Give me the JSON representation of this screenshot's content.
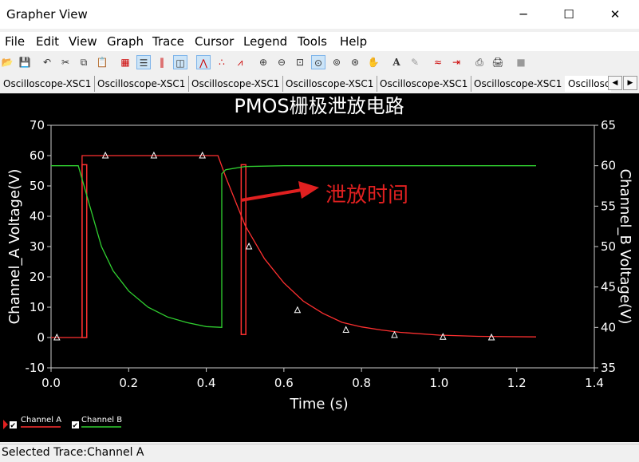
{
  "window": {
    "title": "Grapher View",
    "minimize": "─",
    "maximize": "☐",
    "close": "✕"
  },
  "menu": [
    "File",
    "Edit",
    "View",
    "Graph",
    "Trace",
    "Cursor",
    "Legend",
    "Tools",
    "Help"
  ],
  "toolbar_icons": [
    "open-icon",
    "save-icon",
    "undo-icon",
    "cut-icon",
    "copy-icon",
    "paste-icon",
    "grid-icon",
    "legend-icon",
    "cursors-icon",
    "overlay-icon",
    "line-trace-icon",
    "dot-trace-icon",
    "marker-trace-icon",
    "zoom-in-icon",
    "zoom-out-icon",
    "zoom-fit-icon",
    "zoom-x-icon",
    "zoom-y-icon",
    "zoom-region-icon",
    "pan-icon",
    "text-icon",
    "draw-icon",
    "compare-icon",
    "export-icon",
    "print-icon",
    "print-preview-icon",
    "stop-icon"
  ],
  "tabs": [
    "Oscilloscope-XSC1",
    "Oscilloscope-XSC1",
    "Oscilloscope-XSC1",
    "Oscilloscope-XSC1",
    "Oscilloscope-XSC1",
    "Oscilloscope-XSC1",
    "Oscillosc"
  ],
  "tab_scroll": {
    "left": "◀",
    "right": "▶"
  },
  "legend": [
    {
      "label": "Channel A",
      "color": "#ff3030"
    },
    {
      "label": "Channel B",
      "color": "#30d030"
    }
  ],
  "annotation": "泄放时间",
  "status": "Selected Trace:Channel A",
  "chart_data": {
    "type": "line",
    "title": "PMOS栅极泄放电路",
    "xlabel": "Time (s)",
    "ylabel": "Channel_A Voltage(V)",
    "y2label": "Channel_B Voltage(V)",
    "xlim": [
      0,
      1.4
    ],
    "ylim": [
      -10,
      70
    ],
    "y2lim": [
      35,
      65
    ],
    "x_ticks": [
      "0.0",
      "0.2",
      "0.4",
      "0.6",
      "0.8",
      "1.0",
      "1.2",
      "1.4"
    ],
    "y_ticks": [
      "70",
      "60",
      "50",
      "40",
      "30",
      "20",
      "10",
      "0",
      "-10"
    ],
    "y2_ticks": [
      "65",
      "60",
      "55",
      "50",
      "45",
      "40",
      "35"
    ],
    "series": [
      {
        "name": "Channel A",
        "axis": "left",
        "color": "#ff3030",
        "x": [
          0.0,
          0.08,
          0.08,
          0.1,
          0.2,
          0.3,
          0.4,
          0.43,
          0.45,
          0.5,
          0.55,
          0.6,
          0.65,
          0.7,
          0.75,
          0.8,
          0.85,
          0.9,
          1.0,
          1.1,
          1.25
        ],
        "y": [
          0,
          0,
          60,
          60,
          60,
          60,
          60,
          60,
          53,
          37,
          26,
          18,
          12,
          8,
          5,
          3.5,
          2.5,
          1.7,
          0.8,
          0.4,
          0.2
        ]
      },
      {
        "name": "Channel B",
        "axis": "right",
        "color": "#30d030",
        "x": [
          0.0,
          0.07,
          0.1,
          0.13,
          0.16,
          0.2,
          0.25,
          0.3,
          0.35,
          0.4,
          0.44,
          0.44,
          0.45,
          0.5,
          0.6,
          1.25
        ],
        "y": [
          60,
          60,
          55,
          50,
          47,
          44.5,
          42.5,
          41.3,
          40.6,
          40.1,
          40,
          59,
          59.5,
          59.9,
          60,
          60
        ]
      }
    ],
    "markers_a": {
      "x": [
        0.015,
        0.14,
        0.265,
        0.39,
        0.51,
        0.635,
        0.76,
        0.885,
        1.01,
        1.135
      ],
      "y": [
        0,
        60,
        60,
        60,
        30,
        9,
        2.5,
        0.8,
        0.2,
        0
      ]
    },
    "highlight_boxes": [
      {
        "x": [
          0.02,
          0.08
        ],
        "y": [
          0,
          57
        ]
      },
      {
        "x": [
          0.43,
          0.49
        ],
        "y": [
          1,
          57
        ]
      }
    ],
    "grid": false,
    "legend_position": "bottom-left"
  }
}
